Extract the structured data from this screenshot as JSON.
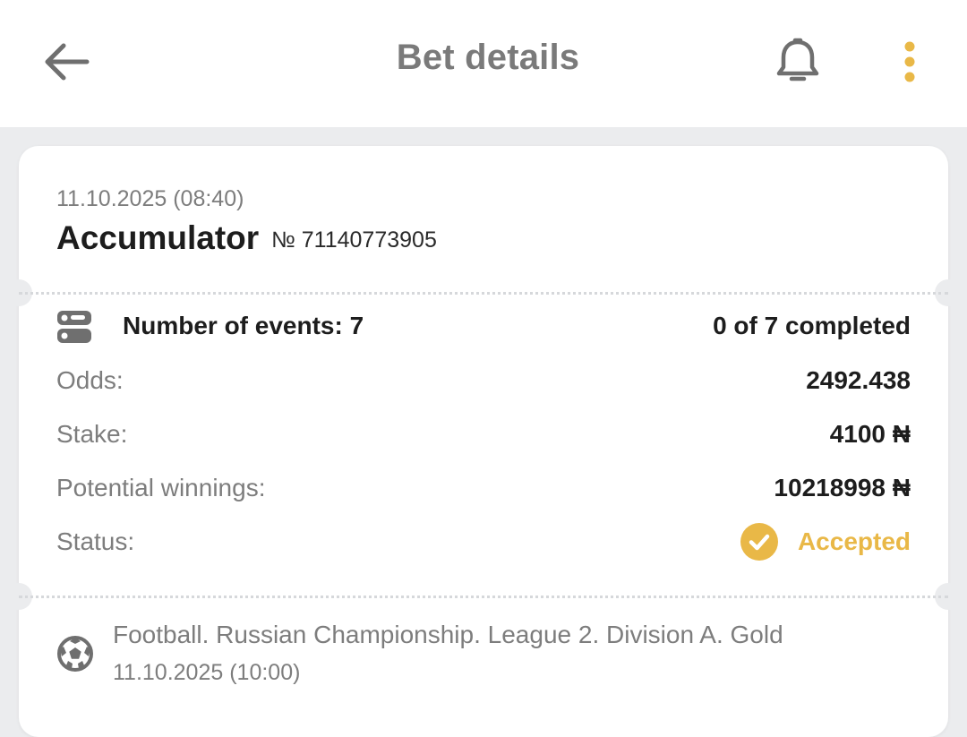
{
  "header": {
    "title": "Bet details",
    "back_icon": "arrow-left-icon",
    "bell_icon": "bell-icon",
    "menu_icon": "more-vertical-icon"
  },
  "bet": {
    "date": "11.10.2025 (08:40)",
    "type": "Accumulator",
    "number": "№ 71140773905"
  },
  "summary": {
    "events_label": "Number of events: 7",
    "completed": "0 of 7 completed",
    "odds_label": "Odds:",
    "odds_value": "2492.438",
    "stake_label": "Stake:",
    "stake_value": "4100 ₦",
    "potential_label": "Potential winnings:",
    "potential_value": "10218998 ₦",
    "status_label": "Status:",
    "status_value": "Accepted"
  },
  "events": [
    {
      "league": "Football. Russian Championship. League 2. Division A. Gold",
      "date": "11.10.2025 (10:00)",
      "icon": "football-icon"
    }
  ],
  "colors": {
    "accent": "#e9b847",
    "background": "#ebecee",
    "card": "#ffffff",
    "text_dark": "#1d1d1d",
    "text_muted": "#7d7d7d",
    "icon_gray": "#757575"
  }
}
